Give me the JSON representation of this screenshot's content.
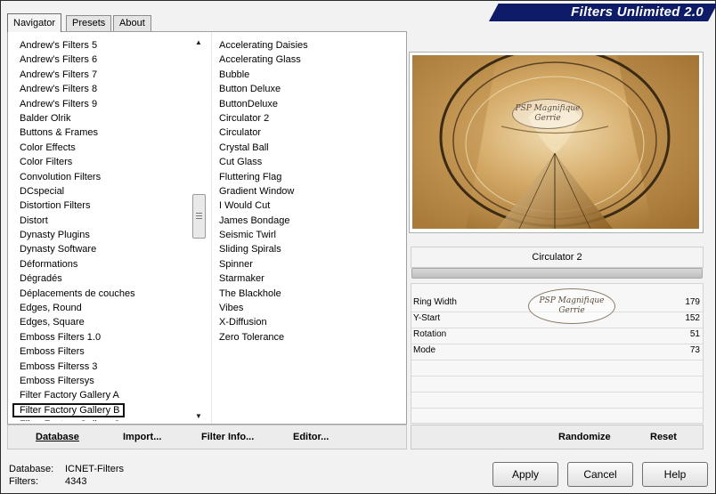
{
  "tabs": [
    {
      "label": "Navigator"
    },
    {
      "label": "Presets"
    },
    {
      "label": "About"
    }
  ],
  "app_title": "Filters Unlimited 2.0",
  "categories": [
    "Andrew's Filters 5",
    "Andrew's Filters 6",
    "Andrew's Filters 7",
    "Andrew's Filters 8",
    "Andrew's Filters 9",
    "Balder Olrik",
    "Buttons & Frames",
    "Color Effects",
    "Color Filters",
    "Convolution Filters",
    "DCspecial",
    "Distortion Filters",
    "Distort",
    "Dynasty Plugins",
    "Dynasty Software",
    "Déformations",
    "Dégradés",
    "Déplacements de couches",
    "Edges, Round",
    "Edges, Square",
    "Emboss Filters 1.0",
    "Emboss Filters",
    "Emboss Filterss 3",
    "Emboss Filtersys",
    "Filter Factory Gallery A",
    "Filter Factory Gallery B",
    "Filter Factory Gallery C"
  ],
  "selected_category": "Filter Factory Gallery B",
  "filters": [
    "Accelerating Daisies",
    "Accelerating Glass",
    "Bubble",
    "Button Deluxe",
    "ButtonDeluxe",
    "Circulator 2",
    "Circulator",
    "Crystal Ball",
    "Cut Glass",
    "Fluttering Flag",
    "Gradient Window",
    "I Would Cut",
    "James Bondage",
    "Seismic Twirl",
    "Sliding Spirals",
    "Spinner",
    "Starmaker",
    "The Blackhole",
    "Vibes",
    "X-Diffusion",
    "Zero Tolerance"
  ],
  "toolbar": {
    "database": "Database",
    "import": "Import...",
    "filter_info": "Filter Info...",
    "editor": "Editor..."
  },
  "preview": {
    "watermark_line1": "PSP Magnifique",
    "watermark_line2": "Gerrie"
  },
  "selected_filter": "Circulator 2",
  "params": [
    {
      "name": "Ring Width",
      "value": "179"
    },
    {
      "name": "Y-Start",
      "value": "152"
    },
    {
      "name": "Rotation",
      "value": "51"
    },
    {
      "name": "Mode",
      "value": "73"
    }
  ],
  "right_toolbar": {
    "randomize": "Randomize",
    "reset": "Reset"
  },
  "footer": {
    "database_label": "Database:",
    "database_value": "ICNET-Filters",
    "filters_label": "Filters:",
    "filters_value": "4343"
  },
  "buttons": {
    "apply": "Apply",
    "cancel": "Cancel",
    "help": "Help"
  },
  "colors": {
    "banner": "#0e1b66",
    "preview_gold": "#c79a52"
  }
}
